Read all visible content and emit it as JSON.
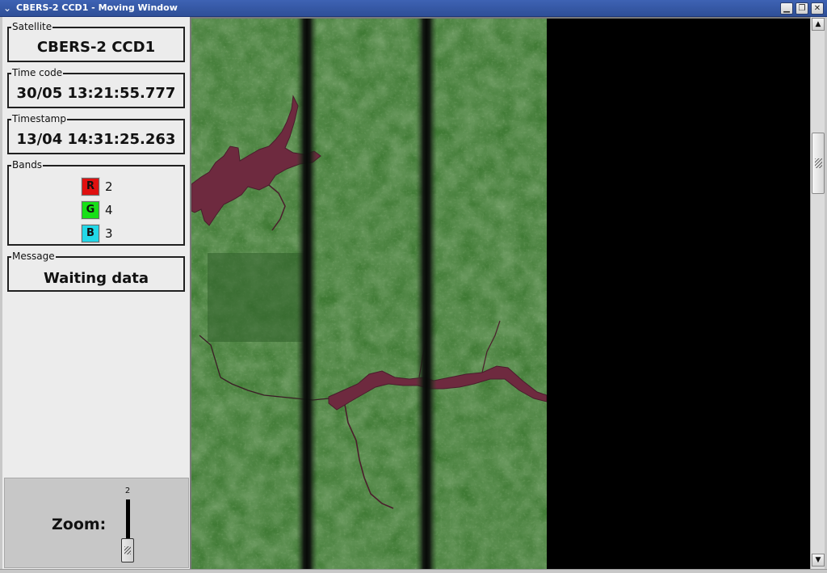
{
  "window": {
    "title": "CBERS-2 CCD1 - Moving Window",
    "menu_icon": "chevron-down-icon",
    "minimize_icon": "minimize-icon",
    "maximize_icon": "restore-icon",
    "close_icon": "close-icon"
  },
  "satellite": {
    "label": "Satellite",
    "value": "CBERS-2 CCD1"
  },
  "time_code": {
    "label": "Time code",
    "value": "30/05 13:21:55.777"
  },
  "timestamp": {
    "label": "Timestamp",
    "value": "13/04 14:31:25.263"
  },
  "bands": {
    "label": "Bands",
    "items": [
      {
        "channel": "R",
        "band": "2",
        "color": "#e01010"
      },
      {
        "channel": "G",
        "band": "4",
        "color": "#18e018"
      },
      {
        "channel": "B",
        "band": "3",
        "color": "#22d8e8"
      }
    ]
  },
  "message": {
    "label": "Message",
    "value": "Waiting data"
  },
  "zoom": {
    "label": "Zoom:",
    "value": "2",
    "level": 1.0
  },
  "image": {
    "description_icon": "satellite-image",
    "vegetation_color": "#3f7a34",
    "water_color": "#6e2a3f",
    "gap_color": "#0f130f"
  },
  "scrollbar": {
    "up_icon": "arrow-up-icon",
    "down_icon": "arrow-down-icon",
    "position": 0.2
  }
}
